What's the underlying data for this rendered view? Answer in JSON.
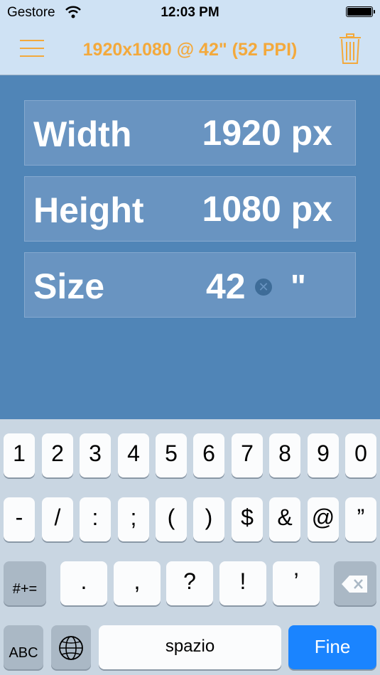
{
  "status_bar": {
    "carrier": "Gestore",
    "time": "12:03 PM"
  },
  "nav": {
    "title": "1920x1080 @ 42\" (52 PPI)",
    "accent_color": "#f3a93c",
    "left_icon": "menu-icon",
    "right_icon": "trash-icon"
  },
  "fields": {
    "width": {
      "label": "Width",
      "value": "1920 px"
    },
    "height": {
      "label": "Height",
      "value": "1080 px"
    },
    "size": {
      "label": "Size",
      "value": "42",
      "unit": "\""
    }
  },
  "keyboard": {
    "row1": [
      "1",
      "2",
      "3",
      "4",
      "5",
      "6",
      "7",
      "8",
      "9",
      "0"
    ],
    "row2": [
      "-",
      "/",
      ":",
      ";",
      "(",
      ")",
      "$",
      "&",
      "@",
      "”"
    ],
    "row3": {
      "switch_label": "#+=",
      "keys": [
        ".",
        ",",
        "?",
        "!",
        "’"
      ]
    },
    "row4": {
      "abc_label": "ABC",
      "space_label": "spazio",
      "done_label": "Fine"
    },
    "done_color": "#1a84ff"
  }
}
